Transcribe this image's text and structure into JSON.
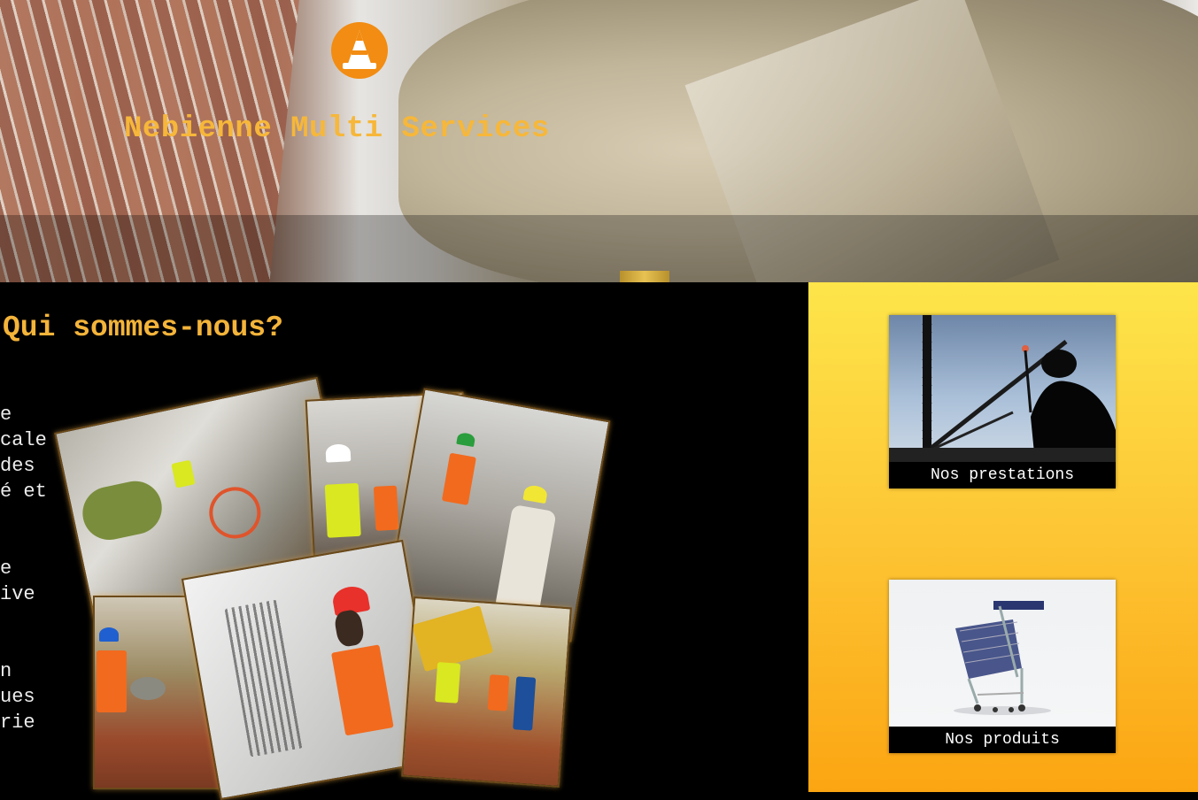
{
  "header": {
    "logo_icon": "traffic-cone-icon",
    "title": "Nebienne Multi Services",
    "accent_color": "#f6b73a",
    "logo_color": "#f28c12"
  },
  "about": {
    "title": "Qui sommes-nous?",
    "paragraphs": [
      [
        "e",
        "cale",
        "des",
        "é et"
      ],
      [
        "e",
        "ive"
      ],
      [
        "n",
        "ues",
        "rie"
      ]
    ]
  },
  "side_panel": {
    "cards": [
      {
        "label": "Nos prestations",
        "image": "crane-worker-silhouette"
      },
      {
        "label": "Nos produits",
        "image": "shopping-cart"
      }
    ]
  }
}
